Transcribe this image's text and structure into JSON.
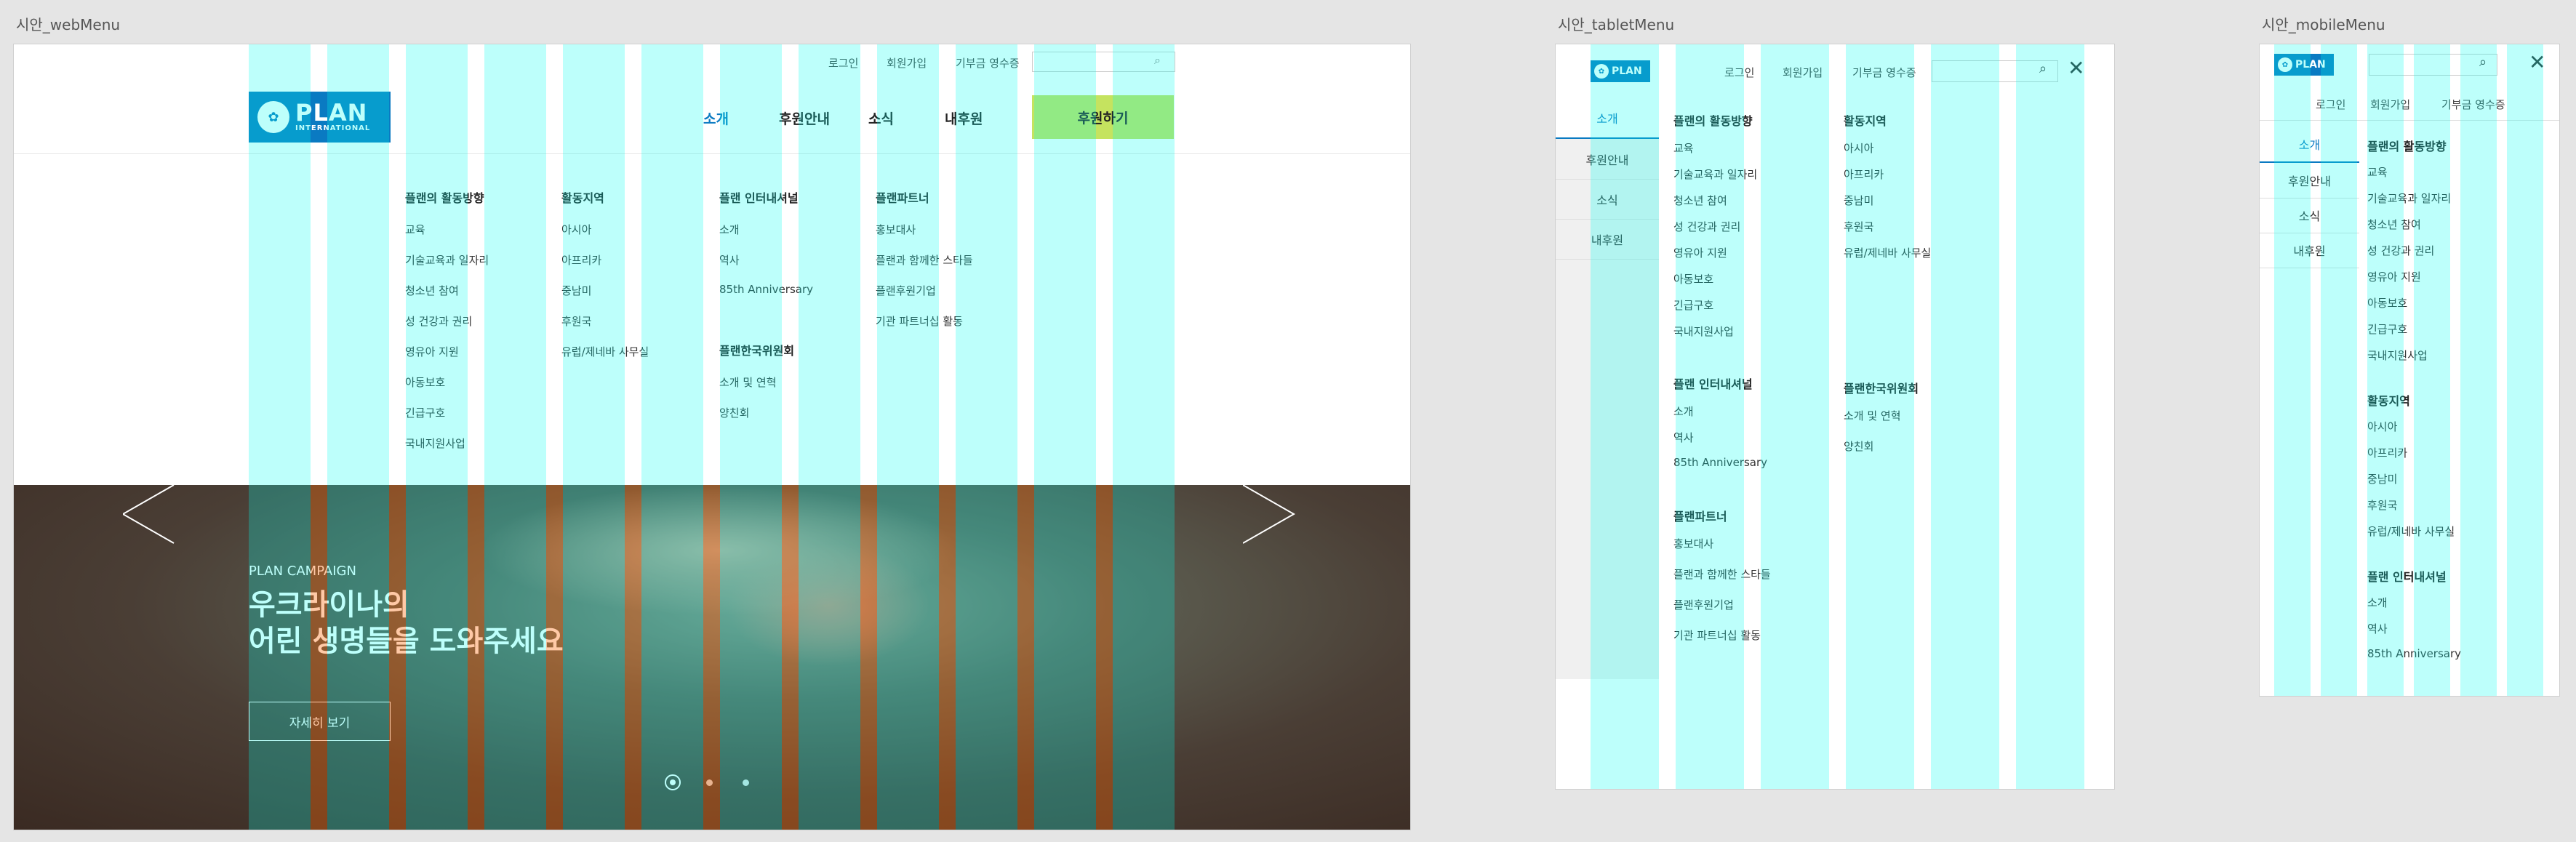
{
  "frames": {
    "web": "시안_webMenu",
    "tablet": "시안_tabletMenu",
    "mobile": "시안_mobileMenu"
  },
  "colors": {
    "brand_blue": "#0a7ac2",
    "donate_green": "#c5e35f",
    "guide_cyan": "#00fff0",
    "guide_orange": "#ff6a00"
  },
  "logo": {
    "word": "PLAN",
    "sub": "INTERNATIONAL"
  },
  "util": {
    "login": "로그인",
    "join": "회원가입",
    "receipt": "기부금 영수증"
  },
  "gnb": {
    "about": "소개",
    "sponsor": "후원안내",
    "news": "소식",
    "my": "내후원",
    "donate": "후원하기"
  },
  "menu": {
    "col1": {
      "heading": "플랜의 활동방향",
      "items": [
        "교육",
        "기술교육과 일자리",
        "청소년 참여",
        "성 건강과 권리",
        "영유아 지원",
        "아동보호",
        "긴급구호",
        "국내지원사업"
      ]
    },
    "col2": {
      "heading": "활동지역",
      "items": [
        "아시아",
        "아프리카",
        "중남미",
        "후원국",
        "유럽/제네바 사무실"
      ]
    },
    "col3": {
      "heading": "플랜 인터내셔널",
      "items": [
        "소개",
        "역사",
        "85th Anniversary"
      ]
    },
    "col3b": {
      "heading": "플랜한국위원회",
      "items": [
        "소개 및 연혁",
        "양친회"
      ]
    },
    "col4": {
      "heading": "플랜파트너",
      "items": [
        "홍보대사",
        "플랜과 함께한 스타들",
        "플랜후원기업",
        "기관 파트너십 활동"
      ]
    }
  },
  "banner": {
    "eyebrow": "PLAN CAMPAIGN",
    "line1": "우크라이나의",
    "line2": "어린 생명들을 도와주세요",
    "button": "자세히 보기",
    "slide_count": 3,
    "active_slide": 1
  },
  "side": [
    "소개",
    "후원안내",
    "소식",
    "내후원"
  ]
}
